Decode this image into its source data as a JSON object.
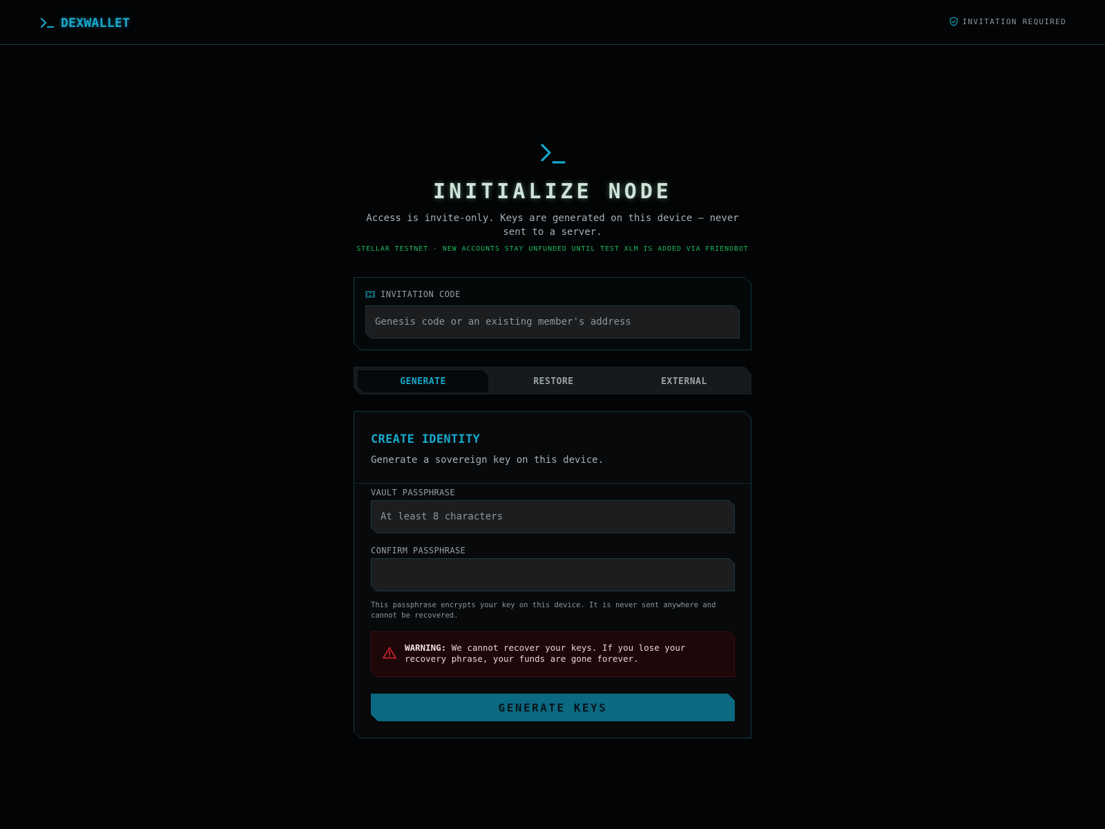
{
  "header": {
    "brand": "DEXWALLET",
    "status": "INVITATION REQUIRED"
  },
  "hero": {
    "title": "INITIALIZE NODE",
    "subtitle": "Access is invite-only. Keys are generated on this device — never sent to a server.",
    "network_note": "STELLAR TESTNET · NEW ACCOUNTS STAY UNFUNDED UNTIL TEST XLM IS ADDED VIA FRIENDBOT"
  },
  "invitation": {
    "label": "INVITATION CODE",
    "value": "",
    "placeholder": "Genesis code or an existing member's address"
  },
  "tabs": [
    {
      "label": "GENERATE",
      "active": true
    },
    {
      "label": "RESTORE",
      "active": false
    },
    {
      "label": "EXTERNAL",
      "active": false
    }
  ],
  "identity": {
    "title": "CREATE IDENTITY",
    "description": "Generate a sovereign key on this device.",
    "passphrase": {
      "label": "VAULT PASSPHRASE",
      "value": "",
      "placeholder": "At least 8 characters"
    },
    "confirm": {
      "label": "CONFIRM PASSPHRASE",
      "value": "",
      "placeholder": ""
    },
    "hint": "This passphrase encrypts your key on this device. It is never sent anywhere and cannot be recovered.",
    "warning_prefix": "WARNING:",
    "warning_text": " We cannot recover your keys. If you lose your recovery phrase, your funds are gone forever.",
    "submit_label": "GENERATE KEYS"
  },
  "icons": {
    "brand": "terminal-prompt-icon",
    "status": "shield-check-icon",
    "invitation": "ticket-icon",
    "warning": "warning-triangle-icon"
  },
  "colors": {
    "accent": "#17a8cc",
    "network": "#1fb85a",
    "warning_border": "#4a0d0f",
    "button": "#0b6981",
    "background": "#030405"
  }
}
